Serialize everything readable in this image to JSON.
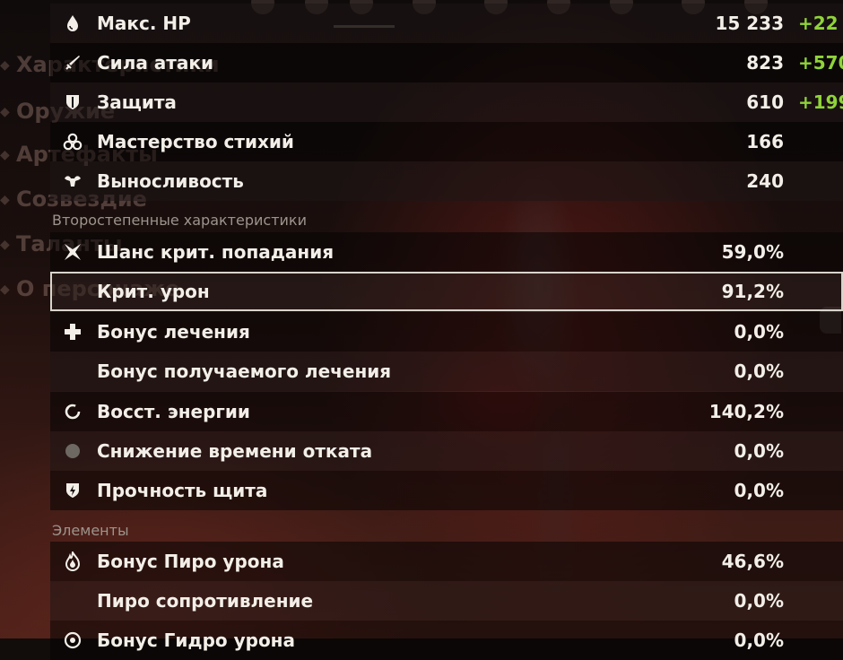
{
  "side_menu": {
    "items": [
      {
        "label": "Характеристики"
      },
      {
        "label": "Оружие"
      },
      {
        "label": "Артефакты"
      },
      {
        "label": "Созвездие"
      },
      {
        "label": "Таланты"
      },
      {
        "label": "О персонаже"
      }
    ]
  },
  "base_stats": [
    {
      "icon": "hp-drop-icon",
      "label": "Макс. HP",
      "value": "15 233",
      "bonus": "+22"
    },
    {
      "icon": "sword-icon",
      "label": "Сила атаки",
      "value": "823",
      "bonus": "+570"
    },
    {
      "icon": "shield-icon",
      "label": "Защита",
      "value": "610",
      "bonus": "+199"
    },
    {
      "icon": "elemental-mastery-icon",
      "label": "Мастерство стихий",
      "value": "166",
      "bonus": ""
    },
    {
      "icon": "stamina-icon",
      "label": "Выносливость",
      "value": "240",
      "bonus": ""
    }
  ],
  "secondary_title": "Второстепенные характеристики",
  "secondary_stats": [
    {
      "icon": "crit-rate-icon",
      "label": "Шанс крит. попадания",
      "value": "59,0%"
    },
    {
      "icon": "",
      "label": "Крит. урон",
      "value": "91,2%"
    },
    {
      "icon": "healing-bonus-icon",
      "label": "Бонус лечения",
      "value": "0,0%"
    },
    {
      "icon": "",
      "label": "Бонус получаемого лечения",
      "value": "0,0%"
    },
    {
      "icon": "energy-recharge-icon",
      "label": "Восст. энергии",
      "value": "140,2%"
    },
    {
      "icon": "cooldown-reduction-icon",
      "label": "Снижение времени отката",
      "value": "0,0%"
    },
    {
      "icon": "shield-strength-icon",
      "label": "Прочность щита",
      "value": "0,0%"
    }
  ],
  "elements_title": "Элементы",
  "element_stats": [
    {
      "icon": "pyro-icon",
      "label": "Бонус Пиро урона",
      "value": "46,6%"
    },
    {
      "icon": "",
      "label": "Пиро сопротивление",
      "value": "0,0%"
    },
    {
      "icon": "hydro-icon",
      "label": "Бонус Гидро урона",
      "value": "0,0%"
    }
  ],
  "colors": {
    "bonus": "#8fd33a",
    "text": "#f3efe8",
    "section": "#9c948c",
    "selected_border": "#d8d4cc"
  }
}
